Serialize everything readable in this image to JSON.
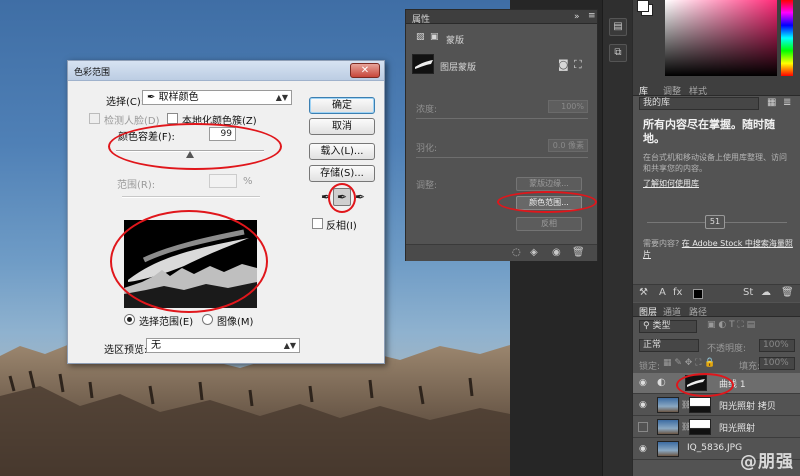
{
  "colors": {
    "accent_red": "#e0161b",
    "dialog_bg": "#f0f0f0",
    "panel_bg": "#535353"
  },
  "dialog": {
    "title": "色彩范围",
    "close_glyph": "✕",
    "select_label": "选择(C):",
    "select_icon": "eyedropper-icon",
    "select_value": "取样颜色",
    "detect_faces_label": "检测人脸(D)",
    "localized_clusters_label": "本地化颜色簇(Z)",
    "fuzziness_label": "颜色容差(F):",
    "fuzziness_value": "99",
    "range_label": "范围(R):",
    "range_value": "",
    "range_unit": "%",
    "radio_selection_label": "选择范围(E)",
    "radio_image_label": "图像(M)",
    "preview_label": "选区预览:",
    "preview_value": "无",
    "buttons": {
      "ok": "确定",
      "cancel": "取消",
      "load": "载入(L)...",
      "save": "存储(S)..."
    },
    "invert_label": "反相(I)"
  },
  "properties": {
    "tab": "属性",
    "subtitle": "蒙版",
    "mask_type": "图层蒙版",
    "density_label": "浓度:",
    "density_value": "100%",
    "feather_label": "羽化:",
    "feather_value": "0.0 像素",
    "adjust_label": "调整:",
    "mask_edge_button": "蒙版边缘...",
    "color_range_button": "颜色范围...",
    "invert_button": "反相"
  },
  "library": {
    "tabs": [
      "库",
      "调整",
      "样式"
    ],
    "dropdown": "我的库",
    "headline": "所有内容尽在掌握。随时随地。",
    "body": "在台式机和移动设备上使用库整理、访问和共享您的内容。",
    "learn_link": "了解如何使用库",
    "stock_prefix": "需要内容?",
    "stock_link": "在 Adobe Stock 中搜索海量照片",
    "counter": "51"
  },
  "layers": {
    "tabs": [
      "图层",
      "通道",
      "路径"
    ],
    "filter": "类型",
    "blend_mode": "正常",
    "opacity_label": "不透明度:",
    "opacity_value": "100%",
    "lock_label": "锁定:",
    "fill_label": "填充:",
    "fill_value": "100%",
    "items": [
      {
        "name": "曲线 1"
      },
      {
        "name": "阳光照射 拷贝"
      },
      {
        "name": "阳光照射"
      },
      {
        "name": "IQ_5836.JPG"
      }
    ]
  },
  "watermark": "@朋强"
}
